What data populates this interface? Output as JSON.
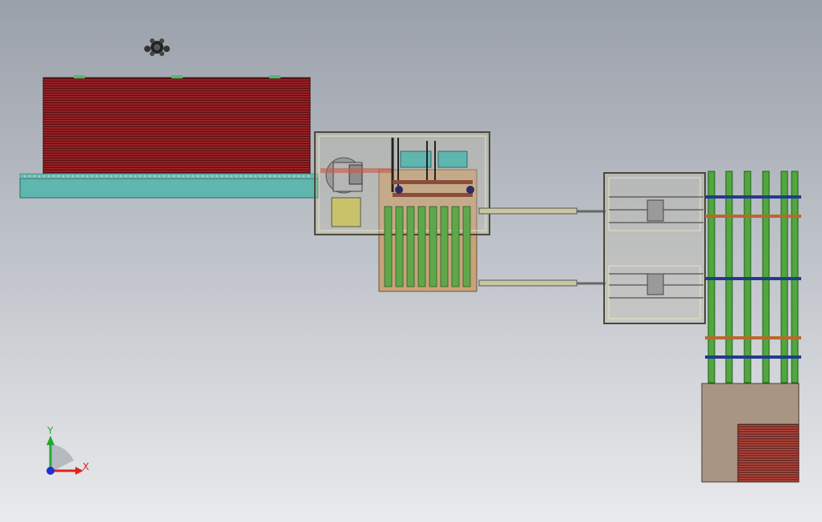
{
  "viewport": {
    "background_top": "#9aa0aa",
    "background_bottom": "#e9eaec"
  },
  "triad": {
    "x_label": "X",
    "y_label": "Y",
    "x_color": "#e0201e",
    "y_color": "#21a831",
    "z_color": "#1f2fd0"
  },
  "model": {
    "stack_color": "#8b1a1a",
    "conveyor_color": "#5fb6ae",
    "frame_color": "#c9c6a2",
    "roller_color": "#4fa83c",
    "base_color": "#a89584",
    "icons": [
      "view-orientation-cube-icon",
      "coordinate-triad-icon"
    ]
  }
}
